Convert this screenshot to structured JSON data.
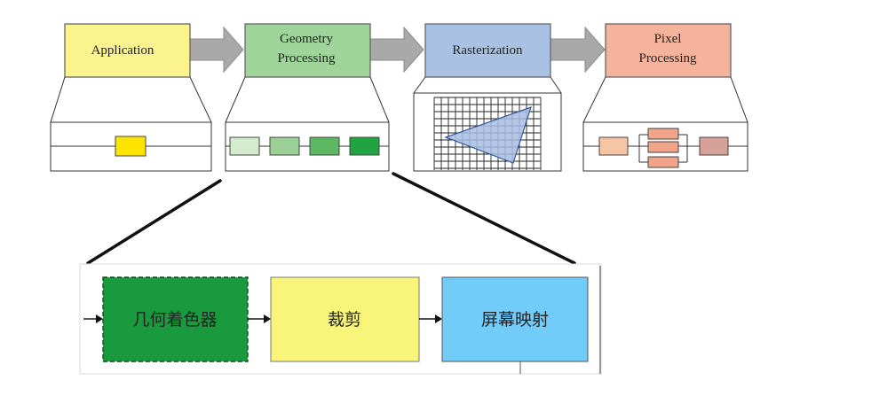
{
  "stages": [
    {
      "id": "application",
      "lines": [
        "Application"
      ],
      "fill": "#fbf38e"
    },
    {
      "id": "geometry",
      "lines": [
        "Geometry",
        "Processing"
      ],
      "fill": "#9fd59a"
    },
    {
      "id": "rasterization",
      "lines": [
        "Rasterization"
      ],
      "fill": "#a9c2e4"
    },
    {
      "id": "pixel",
      "lines": [
        "Pixel",
        "Processing"
      ],
      "fill": "#f6b39c"
    }
  ],
  "detail": {
    "steps": [
      {
        "label": "几何着色器",
        "fill": "#1a9a3e"
      },
      {
        "label": "裁剪",
        "fill": "#f9f57a"
      },
      {
        "label": "屏幕映射",
        "fill": "#72ccf9"
      }
    ]
  },
  "colors": {
    "arrow": "#a9a9a9",
    "app_unit": "#fce400",
    "geometry_units": [
      "#d3ecce",
      "#9bd197",
      "#5db862",
      "#20a441"
    ],
    "pixel_units": [
      "#f7c4a4",
      "#f2a48b",
      "#d6a198"
    ],
    "triangle": "#a7bde2"
  }
}
